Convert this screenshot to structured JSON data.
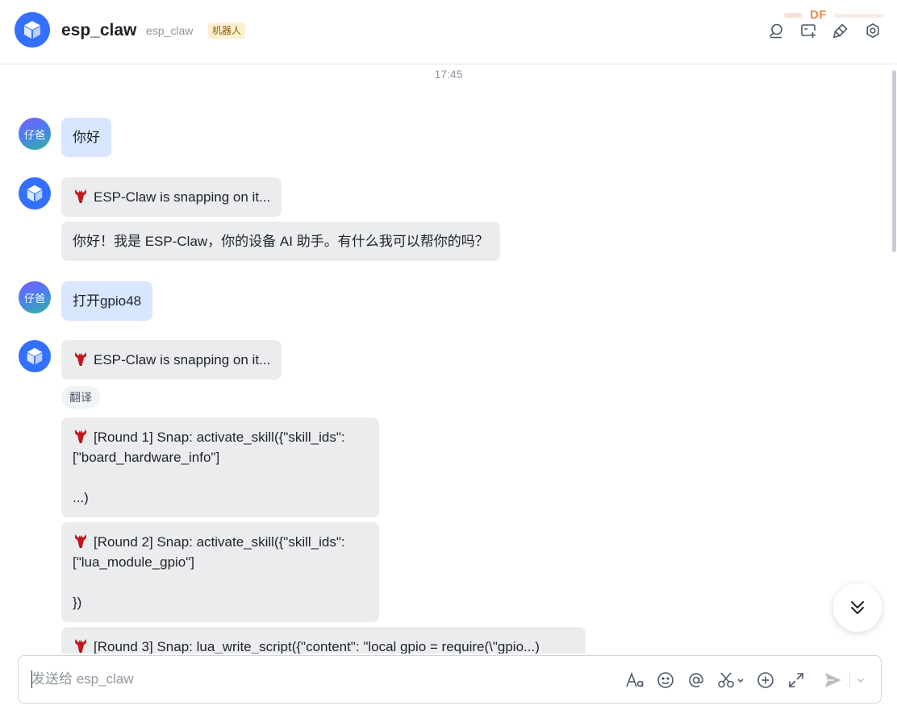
{
  "header": {
    "name": "esp_claw",
    "handle": "esp_claw",
    "badge": "机器人",
    "watermark": "DF"
  },
  "chat": {
    "timestamp": "17:45",
    "user_avatar_text": "仔爸",
    "translate_label": "翻译",
    "messages": [
      {
        "from": "user",
        "text": "你好"
      },
      {
        "from": "bot",
        "text": "ESP-Claw is snapping on it..."
      },
      {
        "from": "bot",
        "text": "你好！我是 ESP-Claw，你的设备 AI 助手。有什么我可以帮你的吗？"
      },
      {
        "from": "user",
        "text": "打开gpio48"
      },
      {
        "from": "bot",
        "text": "ESP-Claw is snapping on it..."
      },
      {
        "from": "bot",
        "text": "[Round 1] Snap: activate_skill({\"skill_ids\":\n[\"board_hardware_info\"]\n\n...)"
      },
      {
        "from": "bot",
        "text": "[Round 2] Snap: activate_skill({\"skill_ids\":\n[\"lua_module_gpio\"]\n\n})"
      },
      {
        "from": "bot",
        "text": "[Round 3] Snap: lua_write_script({\"content\": \"local gpio = require(\\\"gpio...)"
      }
    ]
  },
  "composer": {
    "placeholder": "发送给 esp_claw"
  },
  "colors": {
    "accent": "#3370ff",
    "user_bubble": "#d8e6ff",
    "bot_bubble": "#ebecee",
    "badge_bg": "#fdf0d2"
  },
  "icons": {
    "header_tools": [
      "search-chat-icon",
      "add-to-group-icon",
      "pin-icon",
      "gear-icon"
    ],
    "composer_tools": [
      "text-format-icon",
      "emoji-icon",
      "mention-icon",
      "scissors-icon",
      "add-circle-icon",
      "expand-icon"
    ],
    "send": "send-icon"
  }
}
